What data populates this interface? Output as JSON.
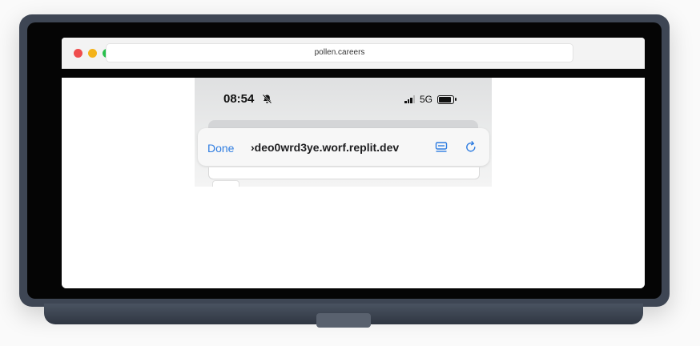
{
  "browser": {
    "url": "pollen.careers",
    "traffic_lights": {
      "close": "#ef4d4d",
      "minimize": "#f4b31a",
      "maximize": "#2ac04d"
    }
  },
  "phone": {
    "status": {
      "time": "08:54",
      "network": "5G",
      "silent_icon": "bell-slash-icon",
      "signal_icon": "signal-bars-icon",
      "battery_icon": "battery-icon"
    },
    "address_bar": {
      "done_label": "Done",
      "url": "›deo0wrd3ye.worf.replit.dev",
      "accent": "#2f7de1"
    }
  }
}
